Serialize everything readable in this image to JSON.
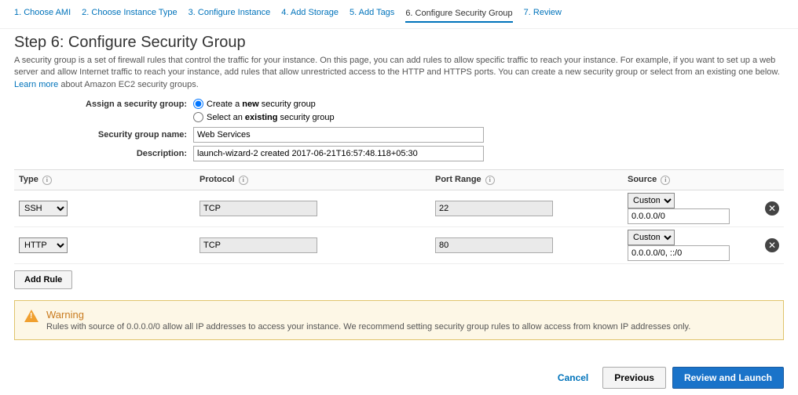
{
  "tabs": {
    "t1": "1. Choose AMI",
    "t2": "2. Choose Instance Type",
    "t3": "3. Configure Instance",
    "t4": "4. Add Storage",
    "t5": "5. Add Tags",
    "t6": "6. Configure Security Group",
    "t7": "7. Review"
  },
  "page": {
    "title": "Step 6: Configure Security Group",
    "desc_pre": "A security group is a set of firewall rules that control the traffic for your instance. On this page, you can add rules to allow specific traffic to reach your instance. For example, if you want to set up a web server and allow Internet traffic to reach your instance, add rules that allow unrestricted access to the HTTP and HTTPS ports. You can create a new security group or select from an existing one below. ",
    "learn_more": "Learn more",
    "desc_post": " about Amazon EC2 security groups."
  },
  "form": {
    "assign_label": "Assign a security group:",
    "create_pre": "Create a ",
    "create_bold": "new",
    "create_post": " security group",
    "select_pre": "Select an ",
    "select_bold": "existing",
    "select_post": " security group",
    "name_label": "Security group name:",
    "name_value": "Web Services",
    "desc_label": "Description:",
    "desc_value": "launch-wizard-2 created 2017-06-21T16:57:48.118+05:30"
  },
  "table": {
    "headers": {
      "type": "Type",
      "protocol": "Protocol",
      "port": "Port Range",
      "source": "Source"
    },
    "rows": [
      {
        "type": "SSH",
        "protocol": "TCP",
        "port": "22",
        "source_sel": "Custom",
        "source_val": "0.0.0.0/0"
      },
      {
        "type": "HTTP",
        "protocol": "TCP",
        "port": "80",
        "source_sel": "Custom",
        "source_val": "0.0.0.0/0, ::/0"
      }
    ],
    "add_rule": "Add Rule"
  },
  "warning": {
    "title": "Warning",
    "text": "Rules with source of 0.0.0.0/0 allow all IP addresses to access your instance. We recommend setting security group rules to allow access from known IP addresses only."
  },
  "footer": {
    "cancel": "Cancel",
    "previous": "Previous",
    "review": "Review and Launch"
  }
}
